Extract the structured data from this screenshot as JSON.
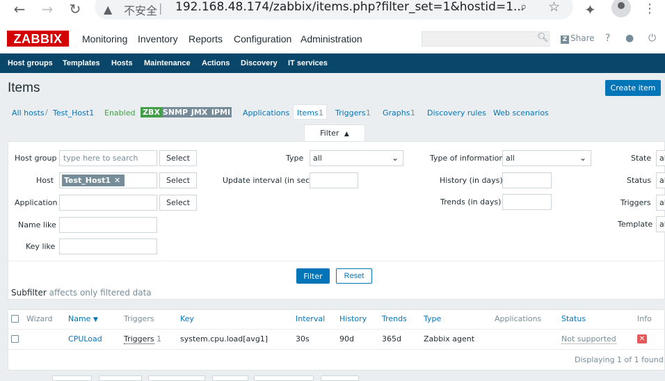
{
  "browser": {
    "insecure_label": "不安全",
    "separator": "|",
    "url": "192.168.48.174/zabbix/items.php?filter_set=1&hostid=1..."
  },
  "topnav": {
    "logo": "ZABBIX",
    "items": [
      "Monitoring",
      "Inventory",
      "Reports",
      "Configuration",
      "Administration"
    ],
    "active": "Configuration",
    "share": "Share",
    "help": "?"
  },
  "subnav": {
    "items": [
      "Host groups",
      "Templates",
      "Hosts",
      "Maintenance",
      "Actions",
      "Discovery",
      "IT services"
    ],
    "active": "Hosts"
  },
  "page": {
    "title": "Items",
    "create_button": "Create item"
  },
  "breadcrumb": {
    "all_hosts": "All hosts",
    "separator": "/",
    "host": "Test_Host1",
    "status": "Enabled",
    "availability": [
      "ZBX",
      "SNMP",
      "JMX",
      "IPMI"
    ],
    "tabs": {
      "applications": "Applications",
      "items": "Items",
      "items_count": "1",
      "triggers": "Triggers",
      "triggers_count": "1",
      "graphs": "Graphs",
      "graphs_count": "1",
      "discovery_rules": "Discovery rules",
      "web_scenarios": "Web scenarios"
    }
  },
  "filter": {
    "tab_label": "Filter",
    "host_group_label": "Host group",
    "host_group_placeholder": "type here to search",
    "select_label": "Select",
    "host_label": "Host",
    "host_value": "Test_Host1",
    "application_label": "Application",
    "name_like_label": "Name like",
    "key_like_label": "Key like",
    "type_label": "Type",
    "type_value": "all",
    "update_interval_label": "Update interval (in sec)",
    "type_of_info_label": "Type of information",
    "type_of_info_value": "all",
    "history_label": "History (in days)",
    "trends_label": "Trends (in days)",
    "state_label": "State",
    "status_label": "Status",
    "triggers_label": "Triggers",
    "template_label": "Template",
    "right_col_value": "al",
    "filter_button": "Filter",
    "reset_button": "Reset"
  },
  "subfilter": {
    "title": "Subfilter",
    "note": "affects only filtered data"
  },
  "table": {
    "headers": [
      "Wizard",
      "Name",
      "Triggers",
      "Key",
      "Interval",
      "History",
      "Trends",
      "Type",
      "Applications",
      "Status",
      "Info"
    ],
    "sort_arrow": "▼",
    "rows": [
      {
        "name": "CPULoad",
        "triggers_label": "Triggers",
        "triggers_count": "1",
        "key": "system.cpu.load[avg1]",
        "interval": "30s",
        "history": "90d",
        "trends": "365d",
        "type": "Zabbix agent",
        "applications": "",
        "status": "Not supported",
        "info_icon": "error-icon"
      }
    ],
    "footer": "Displaying 1 of 1 found"
  },
  "colors": {
    "brand_red": "#d40000",
    "nav_blue": "#0a466a",
    "link_blue": "#0275b8",
    "zbx_green": "#59db8f",
    "grey_tag": "#768d99",
    "error_red": "#e45959"
  }
}
